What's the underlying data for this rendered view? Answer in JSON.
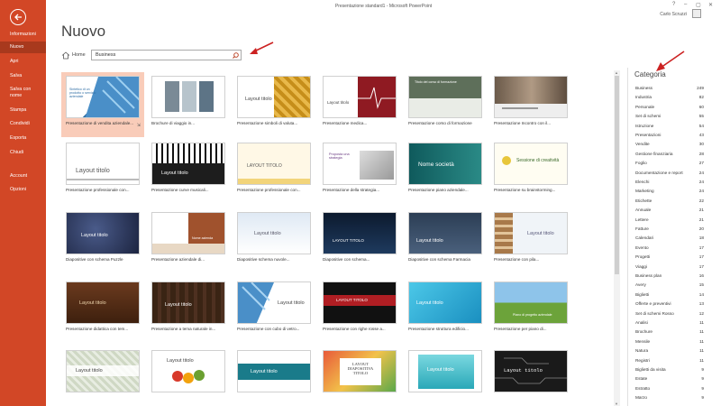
{
  "window": {
    "title": "Presentazione standard1 - Microsoft PowerPoint",
    "user": "Carlo Scruzzi",
    "controls": [
      "?",
      "–",
      "▢",
      "✕"
    ]
  },
  "sidebar": {
    "items": [
      {
        "label": "Informazioni",
        "active": false
      },
      {
        "label": "Nuovo",
        "active": true
      },
      {
        "label": "Apri",
        "active": false
      },
      {
        "label": "Salva",
        "active": false
      },
      {
        "label": "Salva con nome",
        "active": false
      },
      {
        "label": "Stampa",
        "active": false
      },
      {
        "label": "Condividi",
        "active": false
      },
      {
        "label": "Esporta",
        "active": false
      },
      {
        "label": "Chiudi",
        "active": false
      },
      {
        "label": "Account",
        "active": false
      },
      {
        "label": "Opzioni",
        "active": false
      }
    ]
  },
  "page": {
    "title": "Nuovo",
    "home_label": "Home",
    "search_value": "Business"
  },
  "colors": {
    "accent": "#d24726",
    "accent_dark": "#a8391d",
    "annotation": "#cc2222"
  },
  "templates": [
    {
      "caption": "Presentazione di vendita aziendale...",
      "text": "Sintetico di un prodotto o servizio aziendale"
    },
    {
      "caption": "Brochure di viaggio in...",
      "text": ""
    },
    {
      "caption": "Presentazione simboli di valuta...",
      "text": "Layout titolo"
    },
    {
      "caption": "Presentazione medica...",
      "text": "Layout titolo"
    },
    {
      "caption": "Presentazione corso di formazione",
      "text": "Titolo del corso di formazione"
    },
    {
      "caption": "Presentazione Incontro con il...",
      "text": ""
    },
    {
      "caption": "Presentazione professionale con...",
      "text": "Layout titolo"
    },
    {
      "caption": "Presentazione curve musicali...",
      "text": "Layout titolo"
    },
    {
      "caption": "Presentazione professionale con...",
      "text": "LAYOUT TITOLO"
    },
    {
      "caption": "Presentazione della strategia...",
      "text": "Proposta una strategia"
    },
    {
      "caption": "Presentazione piano aziendale...",
      "text": "Nome società"
    },
    {
      "caption": "Presentazione su brainstorming...",
      "text": "Sessione di creatività"
    },
    {
      "caption": "Diapositive con schema Puzzle",
      "text": "Layout titolo"
    },
    {
      "caption": "Presentazione aziendale di...",
      "text": "Nome azienda"
    },
    {
      "caption": "Diapositive schema nuvole...",
      "text": "Layout titolo"
    },
    {
      "caption": "Diapositive con schema...",
      "text": "LAYOUT TITOLO"
    },
    {
      "caption": "Diapositive con schema Farmacia",
      "text": "Layout titolo"
    },
    {
      "caption": "Presentazione con pila...",
      "text": "Layout titolo"
    },
    {
      "caption": "Presentazione didattica con tem...",
      "text": "Layout titolo"
    },
    {
      "caption": "Presentazione a tema naturale in...",
      "text": "Layout titolo"
    },
    {
      "caption": "Presentazione con cubo di vetro...",
      "text": "Layout titolo"
    },
    {
      "caption": "Presentazione con righe rosse a...",
      "text": "LAYOUT TITOLO"
    },
    {
      "caption": "Presentazione struttura edificio...",
      "text": "Layout titolo"
    },
    {
      "caption": "Presentazione per piano di...",
      "text": "Piano di progetto aziendale"
    },
    {
      "caption": "",
      "text": "Layout titolo"
    },
    {
      "caption": "",
      "text": "Layout titolo"
    },
    {
      "caption": "",
      "text": "Layout titolo"
    },
    {
      "caption": "",
      "text": "LAYOUT DIAPOSITIVA TITOLO"
    },
    {
      "caption": "",
      "text": "Layout titolo"
    },
    {
      "caption": "",
      "text": "Layout titolo"
    }
  ],
  "categories": {
    "title": "Categoria",
    "items": [
      {
        "label": "Business",
        "count": "249"
      },
      {
        "label": "Industria",
        "count": "82"
      },
      {
        "label": "Personale",
        "count": "60"
      },
      {
        "label": "Set di schemi",
        "count": "55"
      },
      {
        "label": "Istruzione",
        "count": "54"
      },
      {
        "label": "Presentazioni",
        "count": "43"
      },
      {
        "label": "Vendite",
        "count": "30"
      },
      {
        "label": "Gestione finanziaria",
        "count": "28"
      },
      {
        "label": "Foglio",
        "count": "27"
      },
      {
        "label": "Documentazione e report",
        "count": "24"
      },
      {
        "label": "Elenchi",
        "count": "24"
      },
      {
        "label": "Marketing",
        "count": "24"
      },
      {
        "label": "Etichette",
        "count": "22"
      },
      {
        "label": "Annuale",
        "count": "21"
      },
      {
        "label": "Lettere",
        "count": "21"
      },
      {
        "label": "Fatture",
        "count": "20"
      },
      {
        "label": "Calendari",
        "count": "18"
      },
      {
        "label": "Evento",
        "count": "17"
      },
      {
        "label": "Progetti",
        "count": "17"
      },
      {
        "label": "Viaggi",
        "count": "17"
      },
      {
        "label": "Business plan",
        "count": "16"
      },
      {
        "label": "Avery",
        "count": "15"
      },
      {
        "label": "Biglietti",
        "count": "14"
      },
      {
        "label": "Offerte e preventivi",
        "count": "13"
      },
      {
        "label": "Set di schemi Rosso",
        "count": "12"
      },
      {
        "label": "Analisi",
        "count": "11"
      },
      {
        "label": "Brochure",
        "count": "11"
      },
      {
        "label": "Mensile",
        "count": "11"
      },
      {
        "label": "Natura",
        "count": "11"
      },
      {
        "label": "Registri",
        "count": "11"
      },
      {
        "label": "Biglietti da visita",
        "count": "9"
      },
      {
        "label": "Estate",
        "count": "9"
      },
      {
        "label": "Estratto",
        "count": "9"
      },
      {
        "label": "Marzo",
        "count": "9"
      }
    ]
  }
}
